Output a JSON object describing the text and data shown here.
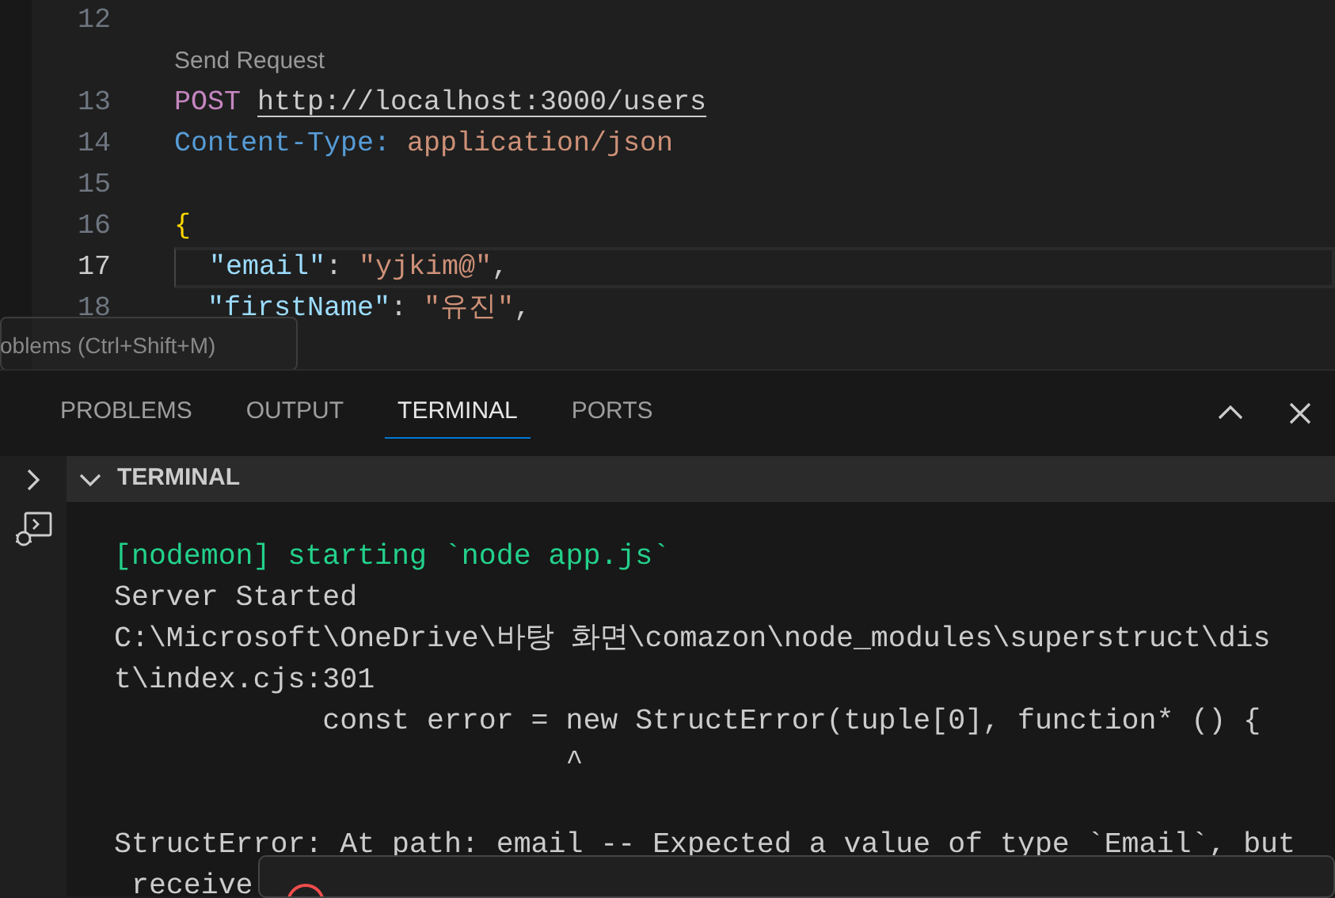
{
  "editor": {
    "lines": [
      {
        "kind": "code",
        "number": "12",
        "current": false
      },
      {
        "kind": "codelens",
        "text": "Send Request"
      },
      {
        "kind": "code",
        "number": "13",
        "current": false,
        "tokens": [
          {
            "kind": "method",
            "text": "POST"
          },
          {
            "kind": "url",
            "text": "http://localhost:3000/users"
          }
        ]
      },
      {
        "kind": "code",
        "number": "14",
        "current": false,
        "tokens": [
          {
            "kind": "header",
            "text": "Content-Type:"
          },
          {
            "kind": "string",
            "text": "application/json"
          }
        ]
      },
      {
        "kind": "code",
        "number": "15",
        "current": false
      },
      {
        "kind": "code",
        "number": "16",
        "current": false,
        "tokens": [
          {
            "kind": "brace",
            "text": "{"
          }
        ]
      },
      {
        "kind": "code",
        "number": "17",
        "current": true,
        "tokens": [
          {
            "kind": "key",
            "text": "\"email\""
          },
          {
            "kind": "plain",
            "text": ": "
          },
          {
            "kind": "string",
            "text": "\"yjkim@\""
          },
          {
            "kind": "plain",
            "text": ","
          }
        ]
      },
      {
        "kind": "code",
        "number": "18",
        "current": false,
        "tokens": [
          {
            "kind": "key",
            "text": "\"firstName\""
          },
          {
            "kind": "plain",
            "text": ": "
          },
          {
            "kind": "string",
            "text": "\"유진\""
          },
          {
            "kind": "plain",
            "text": ","
          }
        ]
      }
    ]
  },
  "tooltip": {
    "text": "oblems (Ctrl+Shift+M)"
  },
  "panel": {
    "tabs": [
      {
        "label": "PROBLEMS",
        "selected": false
      },
      {
        "label": "OUTPUT",
        "selected": false
      },
      {
        "label": "TERMINAL",
        "selected": true
      },
      {
        "label": "PORTS",
        "selected": false
      }
    ],
    "section": {
      "title": "TERMINAL",
      "expanded": true
    },
    "terminal_lines": [
      {
        "kind": "success",
        "text": "[nodemon] starting `node app.js`"
      },
      {
        "kind": "plain",
        "text": "Server Started"
      },
      {
        "kind": "plain",
        "text": "C:\\Microsoft\\OneDrive\\바탕 화면\\comazon\\node_modules\\superstruct\\dis"
      },
      {
        "kind": "plain",
        "text": "t\\index.cjs:301"
      },
      {
        "kind": "plain",
        "text": "            const error = new StructError(tuple[0], function* () {"
      },
      {
        "kind": "plain",
        "text": "                          ^"
      },
      {
        "kind": "blank"
      },
      {
        "kind": "plain",
        "text": "StructError: At path: email -- Expected a value of type `Email`, but"
      },
      {
        "kind": "plain",
        "text": " receive"
      }
    ]
  }
}
